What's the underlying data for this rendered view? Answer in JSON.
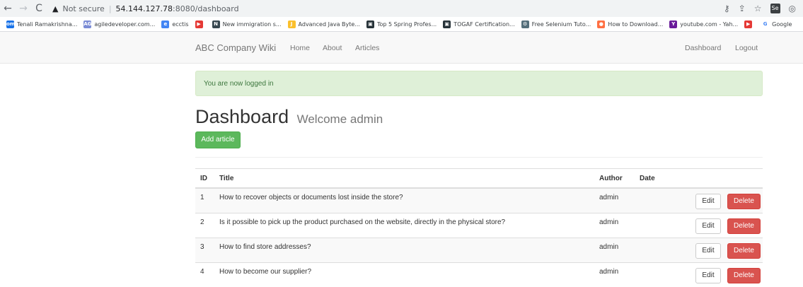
{
  "browser": {
    "nav": {
      "back": "←",
      "forward": "→",
      "reload": "C"
    },
    "security": "Not secure",
    "url_host": "54.144.127.78",
    "url_path": ":8080/dashboard",
    "bookmarks": [
      {
        "label": "Tenali Ramakrishna...",
        "color": "#1a73e8",
        "glyph": "om"
      },
      {
        "label": "agiledeveloper.com...",
        "color": "#7b8cd6",
        "glyph": "AG"
      },
      {
        "label": "ecctis",
        "color": "#4285f4",
        "glyph": "e"
      },
      {
        "label": "",
        "color": "#e53935",
        "glyph": "▶"
      },
      {
        "label": "New immigration s...",
        "color": "#37474f",
        "glyph": "N"
      },
      {
        "label": "Advanced Java Byte...",
        "color": "#fbc02d",
        "glyph": "J"
      },
      {
        "label": "Top 5 Spring Profes...",
        "color": "#263238",
        "glyph": "▣"
      },
      {
        "label": "TOGAF Certification...",
        "color": "#263238",
        "glyph": "▣"
      },
      {
        "label": "Free Selenium Tuto...",
        "color": "#546e7a",
        "glyph": "⚙"
      },
      {
        "label": "How to Download...",
        "color": "#ff7043",
        "glyph": "●"
      },
      {
        "label": "youtube.com - Yah...",
        "color": "#6a1b9a",
        "glyph": "Y"
      },
      {
        "label": "",
        "color": "#e53935",
        "glyph": "▶"
      },
      {
        "label": "Google",
        "color": "#ffffff",
        "glyph": "G"
      }
    ]
  },
  "navbar": {
    "brand": "ABC Company Wiki",
    "links": [
      "Home",
      "About",
      "Articles"
    ],
    "right_links": [
      "Dashboard",
      "Logout"
    ]
  },
  "alert": {
    "text": "You are now logged in"
  },
  "dashboard": {
    "title": "Dashboard",
    "subtitle": "Welcome admin",
    "add_button": "Add article"
  },
  "table": {
    "headers": [
      "ID",
      "Title",
      "Author",
      "Date"
    ],
    "rows": [
      {
        "id": "1",
        "title": "How to recover objects or documents lost inside the store?",
        "author": "admin",
        "date": ""
      },
      {
        "id": "2",
        "title": "Is it possible to pick up the product purchased on the website, directly in the physical store?",
        "author": "admin",
        "date": ""
      },
      {
        "id": "3",
        "title": "How to find store addresses?",
        "author": "admin",
        "date": ""
      },
      {
        "id": "4",
        "title": "How to become our supplier?",
        "author": "admin",
        "date": ""
      }
    ],
    "edit_label": "Edit",
    "delete_label": "Delete"
  }
}
